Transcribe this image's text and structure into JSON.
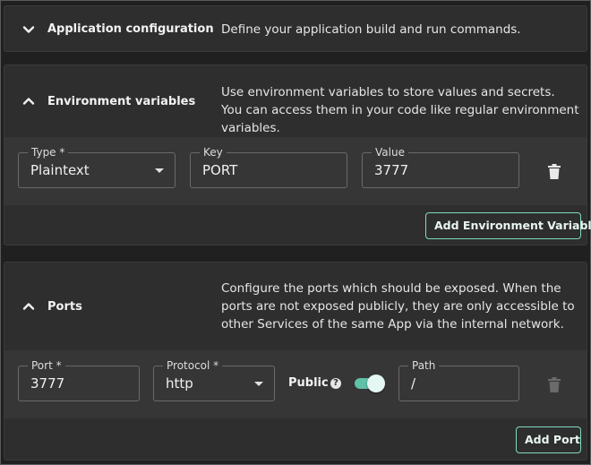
{
  "app_config": {
    "title": "Application configuration",
    "description": "Define your application build and run commands."
  },
  "env_vars": {
    "title": "Environment variables",
    "description": "Use environment variables to store values and secrets. You can access them in your code like regular environment variables.",
    "row": {
      "type_label": "Type *",
      "type_value": "Plaintext",
      "key_label": "Key",
      "key_value": "PORT",
      "value_label": "Value",
      "value_value": "3777"
    },
    "add_button": "Add Environment Variable"
  },
  "ports": {
    "title": "Ports",
    "description": "Configure the ports which should be exposed. When the ports are not exposed publicly, they are only accessible to other Services of the same App via the internal network.",
    "row": {
      "port_label": "Port *",
      "port_value": "3777",
      "protocol_label": "Protocol *",
      "protocol_value": "http",
      "public_label": "Public",
      "public_enabled": true,
      "path_label": "Path",
      "path_value": "/"
    },
    "add_button": "Add Port"
  },
  "icons": {
    "collapse": "chevron-down-icon",
    "expand": "chevron-up-icon",
    "delete": "trash-icon",
    "help": "question-circle-icon"
  },
  "colors": {
    "accent": "#7fd9c2",
    "toggle_on": "#5fc1a8",
    "panel": "#2e2e2e",
    "band": "#363636"
  }
}
